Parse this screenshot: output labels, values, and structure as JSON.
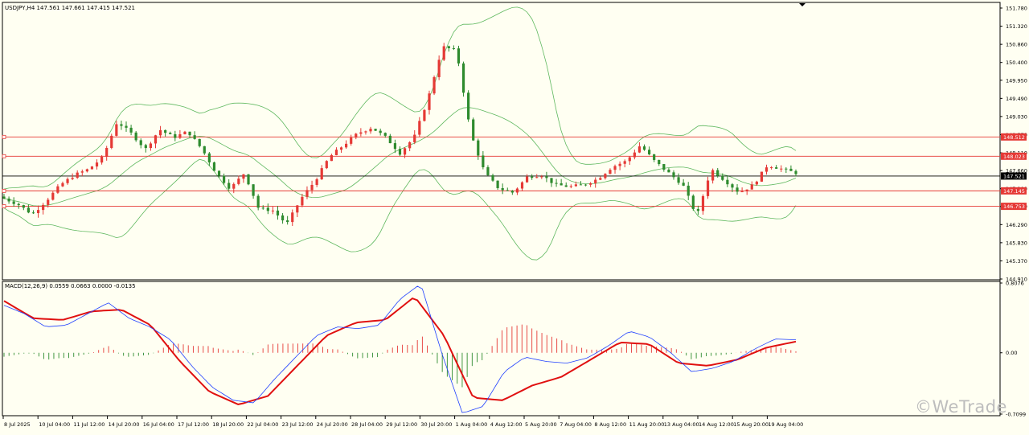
{
  "header": {
    "symbol_info": "USDJPY,H4  147.561 147.661 147.415 147.521",
    "macd_info": "MACD(12,26,9) 0.0559 0.0663 0.0000 -0.0135"
  },
  "watermark": "©WeTrade",
  "colors": {
    "background": "#fffff2",
    "bull": "#e53935",
    "bear": "#2e8b2e",
    "band": "#5fb85f",
    "level": "#e53935",
    "macd_line": "#1f3fff",
    "signal_line": "#e01010"
  },
  "price_axis": {
    "ticks": [
      "151.780",
      "151.320",
      "150.860",
      "150.400",
      "149.950",
      "149.490",
      "149.030",
      "148.570",
      "148.110",
      "147.660",
      "147.200",
      "146.750",
      "146.290",
      "145.830",
      "145.370",
      "144.910"
    ],
    "labels": [
      {
        "text": "148.512",
        "value": 148.512,
        "style": "level"
      },
      {
        "text": "148.023",
        "value": 148.023,
        "style": "level"
      },
      {
        "text": "147.521",
        "value": 147.521,
        "style": "current"
      },
      {
        "text": "147.145",
        "value": 147.145,
        "style": "level"
      },
      {
        "text": "146.753",
        "value": 146.753,
        "style": "level"
      }
    ]
  },
  "macd_axis": {
    "ticks": [
      "0.8076",
      "0.00",
      "-0.7099"
    ]
  },
  "time_axis": {
    "labels": [
      "8 Jul 2025",
      "10 Jul 04:00",
      "11 Jul 12:00",
      "14 Jul 20:00",
      "16 Jul 04:00",
      "17 Jul 12:00",
      "18 Jul 20:00",
      "22 Jul 04:00",
      "23 Jul 12:00",
      "24 Jul 20:00",
      "28 Jul 04:00",
      "29 Jul 12:00",
      "30 Jul 20:00",
      "1 Aug 04:00",
      "4 Aug 12:00",
      "5 Aug 20:00",
      "7 Aug 04:00",
      "8 Aug 12:00",
      "11 Aug 20:00",
      "13 Aug 04:00",
      "14 Aug 12:00",
      "15 Aug 20:00",
      "19 Aug 04:00"
    ]
  },
  "chart_data": {
    "type": "line",
    "symbol": "USDJPY",
    "timeframe": "H4",
    "current_price": 147.521,
    "ylim": [
      144.91,
      151.78
    ],
    "horizontal_levels": [
      148.512,
      148.023,
      147.145,
      146.753
    ],
    "close_path": [
      146.95,
      146.8,
      146.55,
      146.9,
      147.3,
      147.55,
      147.7,
      148.0,
      148.9,
      148.6,
      148.2,
      148.7,
      148.5,
      148.65,
      148.2,
      147.6,
      147.2,
      147.6,
      146.7,
      146.65,
      146.3,
      146.95,
      147.4,
      148.0,
      148.3,
      148.6,
      148.75,
      148.5,
      148.1,
      148.5,
      149.5,
      150.8,
      150.7,
      148.6,
      147.6,
      147.2,
      147.1,
      147.5,
      147.55,
      147.3,
      147.25,
      147.3,
      147.45,
      147.75,
      147.9,
      148.3,
      147.9,
      147.6,
      147.3,
      146.5,
      147.7,
      147.4,
      147.1,
      147.3,
      147.8,
      147.7,
      147.6
    ],
    "macd_path": [
      0.55,
      0.45,
      0.3,
      0.32,
      0.45,
      0.58,
      0.4,
      0.3,
      0.15,
      -0.15,
      -0.4,
      -0.55,
      -0.58,
      -0.3,
      -0.05,
      0.2,
      0.3,
      0.28,
      0.32,
      0.62,
      0.8,
      0.0,
      -0.7,
      -0.62,
      -0.22,
      -0.05,
      -0.1,
      -0.12,
      -0.06,
      0.08,
      0.25,
      0.18,
      0.0,
      -0.22,
      -0.18,
      -0.1,
      0.04,
      0.16,
      0.15
    ],
    "signal_path": [
      0.6,
      0.4,
      0.38,
      0.48,
      0.5,
      0.32,
      -0.1,
      -0.45,
      -0.6,
      -0.5,
      -0.15,
      0.2,
      0.35,
      0.38,
      0.65,
      0.2,
      -0.52,
      -0.55,
      -0.38,
      -0.28,
      -0.08,
      0.12,
      0.1,
      -0.12,
      -0.15,
      -0.08,
      0.06,
      0.13
    ]
  }
}
